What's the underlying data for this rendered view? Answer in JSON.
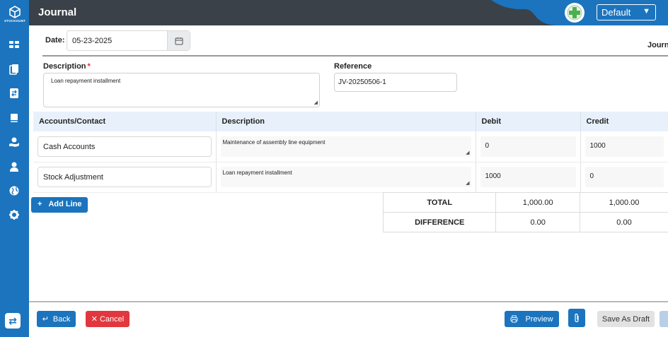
{
  "app": {
    "logo_text": "STOCKOUNT",
    "title": "Journal"
  },
  "topbar": {
    "select_value": "Default",
    "select_caret": "▼"
  },
  "form": {
    "date_label": "Date:",
    "date_value": "05-23-2025",
    "journal_label": "Journ",
    "description_label": "Description",
    "required_mark": "*",
    "description_value": "Loan repayment installment",
    "reference_label": "Reference",
    "reference_value": "JV-20250506-1"
  },
  "table": {
    "headers": [
      "Accounts/Contact",
      "Description",
      "Debit",
      "Credit"
    ],
    "rows": [
      {
        "account": "Cash Accounts",
        "description": "Maintenance of assembly line equipment",
        "debit": "0",
        "credit": "1000"
      },
      {
        "account": "Stock Adjustment",
        "description": "Loan repayment installment",
        "debit": "1000",
        "credit": "0"
      }
    ]
  },
  "add_line_label": "Add Line",
  "totals": {
    "total_label": "TOTAL",
    "total_debit": "1,000.00",
    "total_credit": "1,000.00",
    "difference_label": "DIFFERENCE",
    "difference_debit": "0.00",
    "difference_credit": "0.00"
  },
  "footer": {
    "back_label": "Back",
    "cancel_label": "Cancel",
    "preview_label": "Preview",
    "draft_label": "Save As Draft"
  },
  "colors": {
    "primary": "#1b74bd",
    "topbar": "#3a4149",
    "danger": "#e0383e",
    "header_row": "#e8f1fb"
  },
  "icons": [
    "dashboard-icon",
    "documents-icon",
    "transfer-icon",
    "book-icon",
    "hand-money-icon",
    "user-icon",
    "globe-icon",
    "gear-icon",
    "calendar-icon",
    "print-icon",
    "paperclip-icon"
  ]
}
